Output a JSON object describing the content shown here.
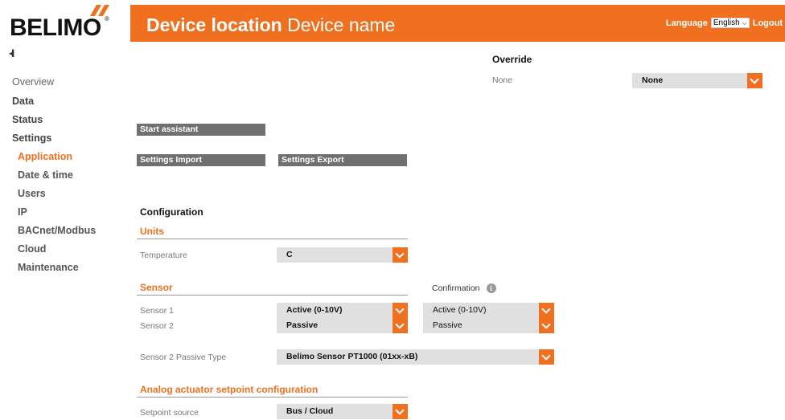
{
  "brand": {
    "logo": "BELIMO",
    "reg": "®"
  },
  "header": {
    "location": "Device location",
    "device": "Device name",
    "language_label": "Language",
    "language_value": "English",
    "logout": "Logout"
  },
  "sidebar": {
    "collapse_icon": "collapse-icon",
    "items": [
      {
        "label": "Overview"
      },
      {
        "label": "Data"
      },
      {
        "label": "Status"
      },
      {
        "label": "Settings"
      },
      {
        "label": "Application"
      },
      {
        "label": "Date & time"
      },
      {
        "label": "Users"
      },
      {
        "label": "IP"
      },
      {
        "label": "BACnet/Modbus"
      },
      {
        "label": "Cloud"
      },
      {
        "label": "Maintenance"
      }
    ]
  },
  "override": {
    "title": "Override",
    "label": "None",
    "value": "None"
  },
  "buttons": {
    "start_assistant": "Start assistant",
    "settings_import": "Settings Import",
    "settings_export": "Settings Export"
  },
  "configuration": {
    "title": "Configuration",
    "units": {
      "title": "Units",
      "temperature_label": "Temperature",
      "temperature_value": "C"
    },
    "sensor": {
      "title": "Sensor",
      "confirmation_label": "Confirmation",
      "sensor1_label": "Sensor 1",
      "sensor1_value": "Active (0-10V)",
      "sensor1_confirm": "Active (0-10V)",
      "sensor2_label": "Sensor 2",
      "sensor2_value": "Passive",
      "sensor2_confirm": "Passive",
      "passive_type_label": "Sensor 2 Passive Type",
      "passive_type_value": "Belimo Sensor PT1000 (01xx-xB)"
    },
    "analog": {
      "title": "Analog actuator setpoint configuration",
      "setpoint_source_label": "Setpoint source",
      "setpoint_source_value": "Bus / Cloud"
    }
  },
  "colors": {
    "accent": "#f07020",
    "button": "#707070",
    "select_bg": "#e0e0e0"
  }
}
